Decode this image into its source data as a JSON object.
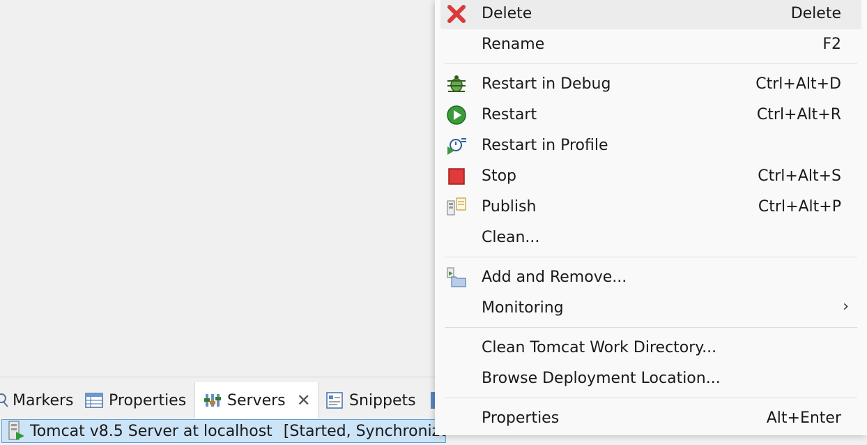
{
  "menu": {
    "items": [
      {
        "label": "Delete",
        "shortcut": "Delete",
        "icon": "delete-icon"
      },
      {
        "label": "Rename",
        "shortcut": "F2"
      },
      {
        "label": "Restart in Debug",
        "shortcut": "Ctrl+Alt+D",
        "icon": "debug-icon"
      },
      {
        "label": "Restart",
        "shortcut": "Ctrl+Alt+R",
        "icon": "restart-icon"
      },
      {
        "label": "Restart in Profile",
        "shortcut": "",
        "icon": "profile-icon"
      },
      {
        "label": "Stop",
        "shortcut": "Ctrl+Alt+S",
        "icon": "stop-icon"
      },
      {
        "label": "Publish",
        "shortcut": "Ctrl+Alt+P",
        "icon": "publish-icon"
      },
      {
        "label": "Clean...",
        "shortcut": ""
      },
      {
        "label": "Add and Remove...",
        "shortcut": "",
        "icon": "add-remove-icon"
      },
      {
        "label": "Monitoring",
        "shortcut": "",
        "submenu": true
      },
      {
        "label": "Clean Tomcat Work Directory...",
        "shortcut": ""
      },
      {
        "label": "Browse Deployment Location...",
        "shortcut": ""
      },
      {
        "label": "Properties",
        "shortcut": "Alt+Enter"
      }
    ]
  },
  "tabs": [
    {
      "label": "Markers",
      "icon": "markers-icon"
    },
    {
      "label": "Properties",
      "icon": "properties-icon"
    },
    {
      "label": "Servers",
      "icon": "servers-icon"
    },
    {
      "label": "Snippets",
      "icon": "snippets-icon"
    }
  ],
  "servers": {
    "row_name": "Tomcat v8.5 Server at localhost",
    "row_status": "[Started, Synchronized]"
  },
  "colors": {
    "selection": "#cce4f7",
    "selection_border": "#5ea0d6",
    "delete_red": "#d93b3b",
    "stop_red": "#e03a3a",
    "run_green": "#3c9a3c"
  }
}
